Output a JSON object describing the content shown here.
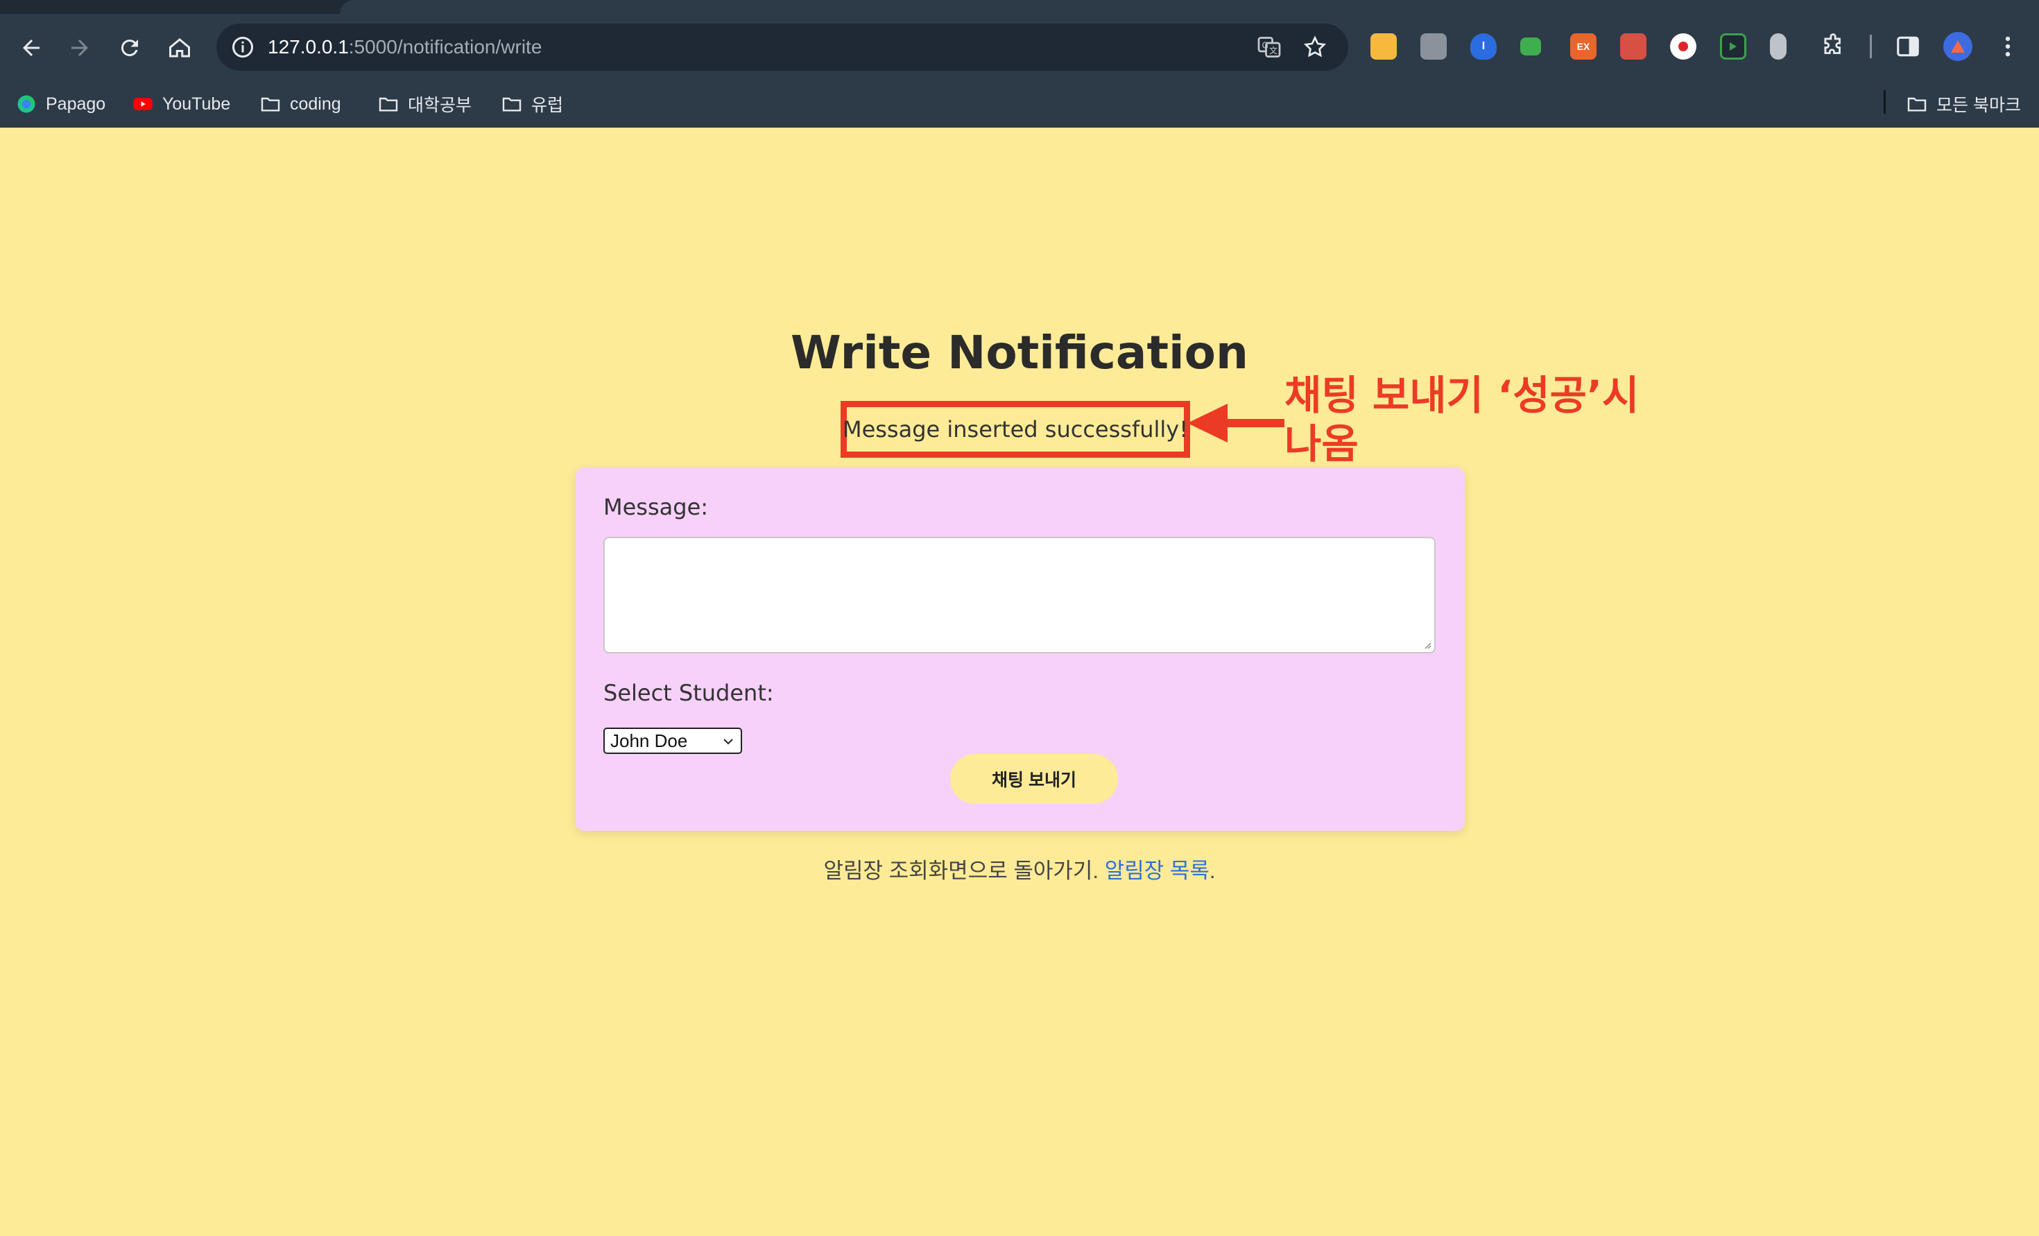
{
  "browser": {
    "url_host": "127.0.0.1",
    "url_rest": ":5000/notification/write",
    "bookmarks": [
      {
        "label": "Papago",
        "icon": "papago-icon"
      },
      {
        "label": "YouTube",
        "icon": "youtube-icon"
      },
      {
        "label": "coding",
        "icon": "folder-icon"
      },
      {
        "label": "대학공부",
        "icon": "folder-icon"
      },
      {
        "label": "유럽",
        "icon": "folder-icon"
      }
    ],
    "all_bookmarks": "모든 북마크",
    "extensions": [
      {
        "name": "extension-yellow-icon",
        "color": "#f5b93e",
        "text": ""
      },
      {
        "name": "extension-camera-icon",
        "color": "#8a939c",
        "text": ""
      },
      {
        "name": "extension-shield-icon",
        "color": "#2b6de0",
        "text": "I"
      },
      {
        "name": "extension-green-icon",
        "color": "#3fae4f",
        "text": ""
      },
      {
        "name": "extension-ex-icon",
        "color": "#e8662c",
        "text": "EX"
      },
      {
        "name": "extension-printer-icon",
        "color": "#d84f43",
        "text": ""
      },
      {
        "name": "extension-record-icon",
        "color": "#ffffff",
        "text": ""
      },
      {
        "name": "extension-play-icon",
        "color": "#39a24c",
        "text": ""
      },
      {
        "name": "extension-mouse-icon",
        "color": "#bdc3c9",
        "text": ""
      }
    ]
  },
  "page": {
    "title": "Write Notification",
    "flash_message": "Message inserted successfully!",
    "annotation": "채팅 보내기 ‘성공’시 나옴",
    "form": {
      "message_label": "Message:",
      "message_value": "",
      "student_label": "Select Student:",
      "student_selected": "John Doe",
      "submit_label": "채팅 보내기"
    },
    "footer_text": "알림장 조회화면으로 돌아가기.",
    "footer_link": "알림장 목록",
    "footer_period": "."
  },
  "colors": {
    "background": "#fdeb97",
    "card": "#f7d1f9",
    "annotation": "#ec3b25",
    "link": "#2f6fd8"
  }
}
